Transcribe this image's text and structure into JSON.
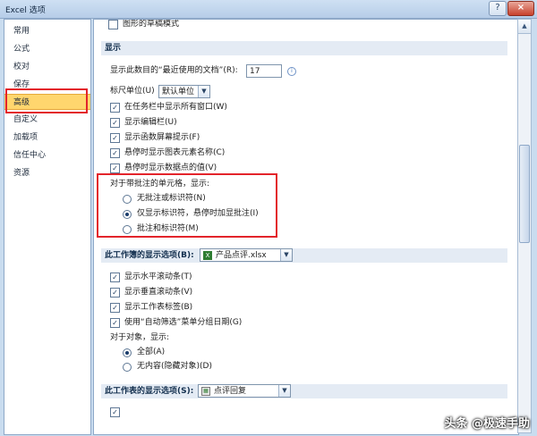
{
  "window": {
    "title": "Excel 选项",
    "help_glyph": "?",
    "close_glyph": "×"
  },
  "sidebar": {
    "items": [
      "常用",
      "公式",
      "校对",
      "保存",
      "高级",
      "自定义",
      "加载项",
      "信任中心",
      "资源"
    ]
  },
  "top_partial": {
    "label": "图形的草稿模式"
  },
  "display": {
    "header": "显示",
    "recent_docs_label": "显示此数目的“最近使用的文档”(R):",
    "recent_docs_value": "17",
    "ruler_label": "标尺单位(U)",
    "ruler_value": "默认单位",
    "checks": [
      {
        "label": "在任务栏中显示所有窗口(W)",
        "checked": true
      },
      {
        "label": "显示编辑栏(U)",
        "checked": true
      },
      {
        "label": "显示函数屏幕提示(F)",
        "checked": true
      },
      {
        "label": "悬停时显示图表元素名称(C)",
        "checked": true
      },
      {
        "label": "悬停时显示数据点的值(V)",
        "checked": true
      }
    ],
    "comments_label": "对于带批注的单元格，显示:",
    "comment_options": [
      {
        "label": "无批注或标识符(N)",
        "selected": false
      },
      {
        "label": "仅显示标识符，悬停时加显批注(I)",
        "selected": true
      },
      {
        "label": "批注和标识符(M)",
        "selected": false
      }
    ]
  },
  "workbook": {
    "header": "此工作簿的显示选项(B):",
    "file_value": "产品点评.xlsx",
    "checks": [
      {
        "label": "显示水平滚动条(T)",
        "checked": true
      },
      {
        "label": "显示垂直滚动条(V)",
        "checked": true
      },
      {
        "label": "显示工作表标签(B)",
        "checked": true
      },
      {
        "label": "使用“自动筛选”菜单分组日期(G)",
        "checked": true
      }
    ],
    "objects_label": "对于对象，显示:",
    "object_options": [
      {
        "label": "全部(A)",
        "selected": true
      },
      {
        "label": "无内容(隐藏对象)(D)",
        "selected": false
      }
    ]
  },
  "worksheet": {
    "header": "此工作表的显示选项(S):",
    "sheet_value": "点评回复"
  },
  "watermark": "头条 @极速手助"
}
